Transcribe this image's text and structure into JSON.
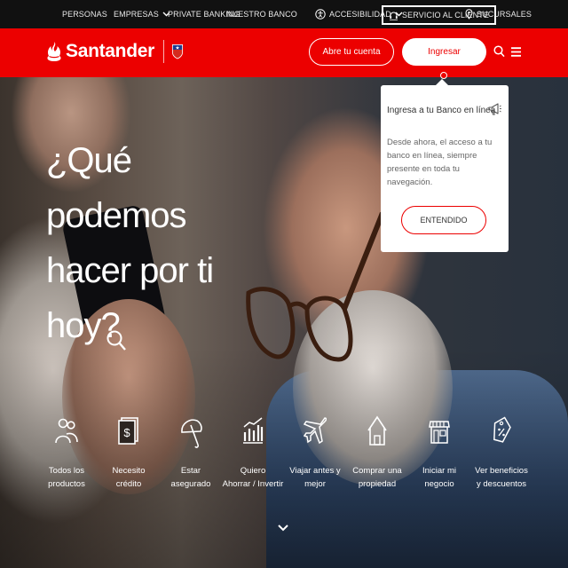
{
  "topbar": {
    "personas": "PERSONAS",
    "empresas": "EMPRESAS",
    "private_banking": "PRIVATE BANKING",
    "nuestro_banco": "NUESTRO BANCO",
    "accesibilidad": "ACCESIBILIDAD",
    "servicio_cliente": "SERVICIO AL CLIENTE",
    "sucursales": "SUCURSALES"
  },
  "header": {
    "brand": "Santander",
    "open_account": "Abre tu cuenta",
    "login": "Ingresar"
  },
  "hero": {
    "headline_lines": [
      "¿Qué",
      "podemos",
      "hacer por ti",
      "hoy?"
    ]
  },
  "categories": [
    {
      "icon": "people-icon",
      "label": "Todos los\nproductos"
    },
    {
      "icon": "money-icon",
      "label": "Necesito\ncrédito"
    },
    {
      "icon": "umbrella-icon",
      "label": "Estar\nasegurado"
    },
    {
      "icon": "chart-icon",
      "label": "Quiero\nAhorrar / Invertir"
    },
    {
      "icon": "plane-icon",
      "label": "Viajar antes y\nmejor"
    },
    {
      "icon": "house-icon",
      "label": "Comprar una\npropiedad"
    },
    {
      "icon": "store-icon",
      "label": "Iniciar mi\nnegocio"
    },
    {
      "icon": "discount-tag-icon",
      "label": "Ver beneficios\ny descuentos"
    }
  ],
  "popover": {
    "title": "Ingresa a tu Banco en línea",
    "body": "Desde ahora, el acceso a tu banco en línea, siempre presente en toda tu navegación.",
    "button": "ENTENDIDO"
  },
  "colors": {
    "brand_red": "#ec0000",
    "topbar": "#111111"
  }
}
